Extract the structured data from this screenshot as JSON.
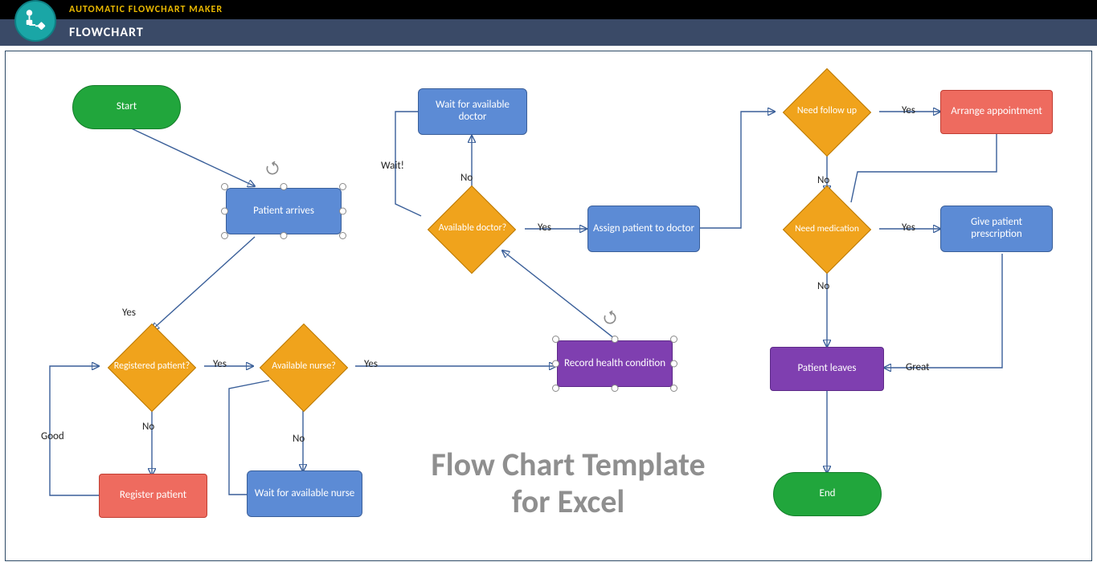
{
  "header": {
    "app_title": "AUTOMATIC FLOWCHART MAKER",
    "section": "FLOWCHART"
  },
  "watermark": {
    "line1": "Flow Chart Template",
    "line2": "for Excel"
  },
  "shapes": {
    "start": {
      "label": "Start"
    },
    "patient_arrives": {
      "label": "Patient arrives"
    },
    "registered": {
      "label": "Registered patient?"
    },
    "register_patient": {
      "label": "Register patient"
    },
    "available_nurse": {
      "label": "Available nurse?"
    },
    "wait_nurse": {
      "label": "Wait for available nurse"
    },
    "record_health": {
      "label": "Record health condition"
    },
    "available_doctor": {
      "label": "Available doctor?"
    },
    "wait_doctor": {
      "label": "Wait for available doctor"
    },
    "assign_doctor": {
      "label": "Assign patient to doctor"
    },
    "need_followup": {
      "label": "Need follow up"
    },
    "arrange_appt": {
      "label": "Arrange appointment"
    },
    "need_med": {
      "label": "Need medication"
    },
    "give_rx": {
      "label": "Give patient prescription"
    },
    "patient_leaves": {
      "label": "Patient leaves"
    },
    "end": {
      "label": "End"
    }
  },
  "edges": {
    "patient_to_registered": "Yes",
    "registered_yes": "Yes",
    "registered_no": "No",
    "register_good": "Good",
    "nurse_yes": "Yes",
    "nurse_no": "No",
    "doctor_yes": "Yes",
    "doctor_no": "No",
    "doctor_wait": "Wait!",
    "followup_yes": "Yes",
    "followup_no": "No",
    "med_yes": "Yes",
    "med_no": "No",
    "leaves_great": "Great"
  },
  "chart_data": {
    "type": "flowchart",
    "title": "Patient Visit Flowchart",
    "nodes": [
      {
        "id": "start",
        "type": "terminator",
        "label": "Start"
      },
      {
        "id": "patient_arrives",
        "type": "process",
        "label": "Patient arrives",
        "selected": true
      },
      {
        "id": "registered",
        "type": "decision",
        "label": "Registered patient?"
      },
      {
        "id": "register_patient",
        "type": "process-critical",
        "label": "Register patient"
      },
      {
        "id": "available_nurse",
        "type": "decision",
        "label": "Available nurse?"
      },
      {
        "id": "wait_nurse",
        "type": "process",
        "label": "Wait for available nurse"
      },
      {
        "id": "record_health",
        "type": "result",
        "label": "Record health condition",
        "selected": true
      },
      {
        "id": "available_doctor",
        "type": "decision",
        "label": "Available doctor?"
      },
      {
        "id": "wait_doctor",
        "type": "process",
        "label": "Wait for available doctor"
      },
      {
        "id": "assign_doctor",
        "type": "process",
        "label": "Assign patient to doctor"
      },
      {
        "id": "need_followup",
        "type": "decision",
        "label": "Need follow up"
      },
      {
        "id": "arrange_appt",
        "type": "process-critical",
        "label": "Arrange appointment"
      },
      {
        "id": "need_med",
        "type": "decision",
        "label": "Need medication"
      },
      {
        "id": "give_rx",
        "type": "process",
        "label": "Give patient prescription"
      },
      {
        "id": "patient_leaves",
        "type": "result",
        "label": "Patient leaves"
      },
      {
        "id": "end",
        "type": "terminator",
        "label": "End"
      }
    ],
    "edges": [
      {
        "from": "start",
        "to": "patient_arrives"
      },
      {
        "from": "patient_arrives",
        "to": "registered",
        "label": "Yes"
      },
      {
        "from": "registered",
        "to": "available_nurse",
        "label": "Yes"
      },
      {
        "from": "registered",
        "to": "register_patient",
        "label": "No"
      },
      {
        "from": "register_patient",
        "to": "registered",
        "label": "Good"
      },
      {
        "from": "available_nurse",
        "to": "record_health",
        "label": "Yes"
      },
      {
        "from": "available_nurse",
        "to": "wait_nurse",
        "label": "No"
      },
      {
        "from": "wait_nurse",
        "to": "available_nurse"
      },
      {
        "from": "record_health",
        "to": "available_doctor"
      },
      {
        "from": "available_doctor",
        "to": "assign_doctor",
        "label": "Yes"
      },
      {
        "from": "available_doctor",
        "to": "wait_doctor",
        "label": "No"
      },
      {
        "from": "wait_doctor",
        "to": "available_doctor",
        "label": "Wait!"
      },
      {
        "from": "assign_doctor",
        "to": "need_followup"
      },
      {
        "from": "need_followup",
        "to": "arrange_appt",
        "label": "Yes"
      },
      {
        "from": "need_followup",
        "to": "need_med",
        "label": "No"
      },
      {
        "from": "arrange_appt",
        "to": "need_med"
      },
      {
        "from": "need_med",
        "to": "give_rx",
        "label": "Yes"
      },
      {
        "from": "need_med",
        "to": "patient_leaves",
        "label": "No"
      },
      {
        "from": "give_rx",
        "to": "patient_leaves",
        "label": "Great"
      },
      {
        "from": "patient_leaves",
        "to": "end"
      }
    ]
  }
}
